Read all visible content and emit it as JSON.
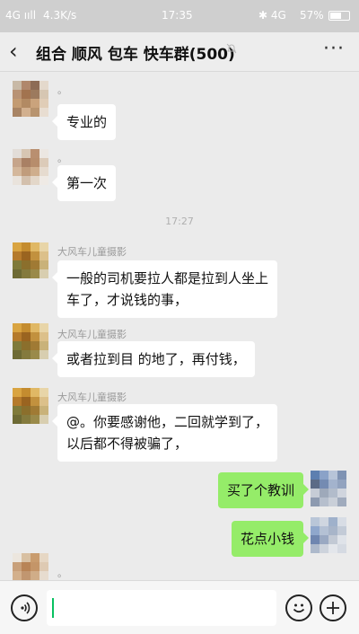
{
  "status_bar": {
    "network": "4G ııll",
    "speed": "4.3K/s",
    "time": "17:35",
    "battery": "57%",
    "signal_extra": "✱ 4G"
  },
  "nav": {
    "back_icon": "‹",
    "title": "组合 顺风 包车 快车群(500)",
    "more_icon": "···"
  },
  "messages": [
    {
      "side": "left",
      "sender": "。",
      "text": "专业的"
    },
    {
      "side": "left",
      "sender": "。",
      "text": "第一次"
    },
    {
      "type": "time",
      "text": "17:27"
    },
    {
      "side": "left",
      "sender": "大风车儿童摄影",
      "lines": [
        "一般的司机要拉人都是拉到人坐上",
        "车了，才说钱的事，"
      ]
    },
    {
      "side": "left",
      "sender": "大风车儿童摄影",
      "text": "或者拉到目 的地了，再付钱，"
    },
    {
      "side": "left",
      "sender": "大风车儿童摄影",
      "lines": [
        "@。你要感谢他，二回就学到了，",
        "以后都不得被骗了，"
      ]
    },
    {
      "side": "right",
      "text": "买了个教训"
    },
    {
      "side": "right",
      "text": "花点小钱"
    },
    {
      "side": "left",
      "sender": "。"
    }
  ],
  "input_bar": {
    "voice_icon": "voice-icon",
    "emoji_icon": "emoji-icon",
    "plus_icon": "plus-icon"
  },
  "colors": {
    "bubble_self": "#95ec69",
    "bubble_other": "#ffffff",
    "background": "#ebebeb",
    "caret": "#07c160"
  }
}
